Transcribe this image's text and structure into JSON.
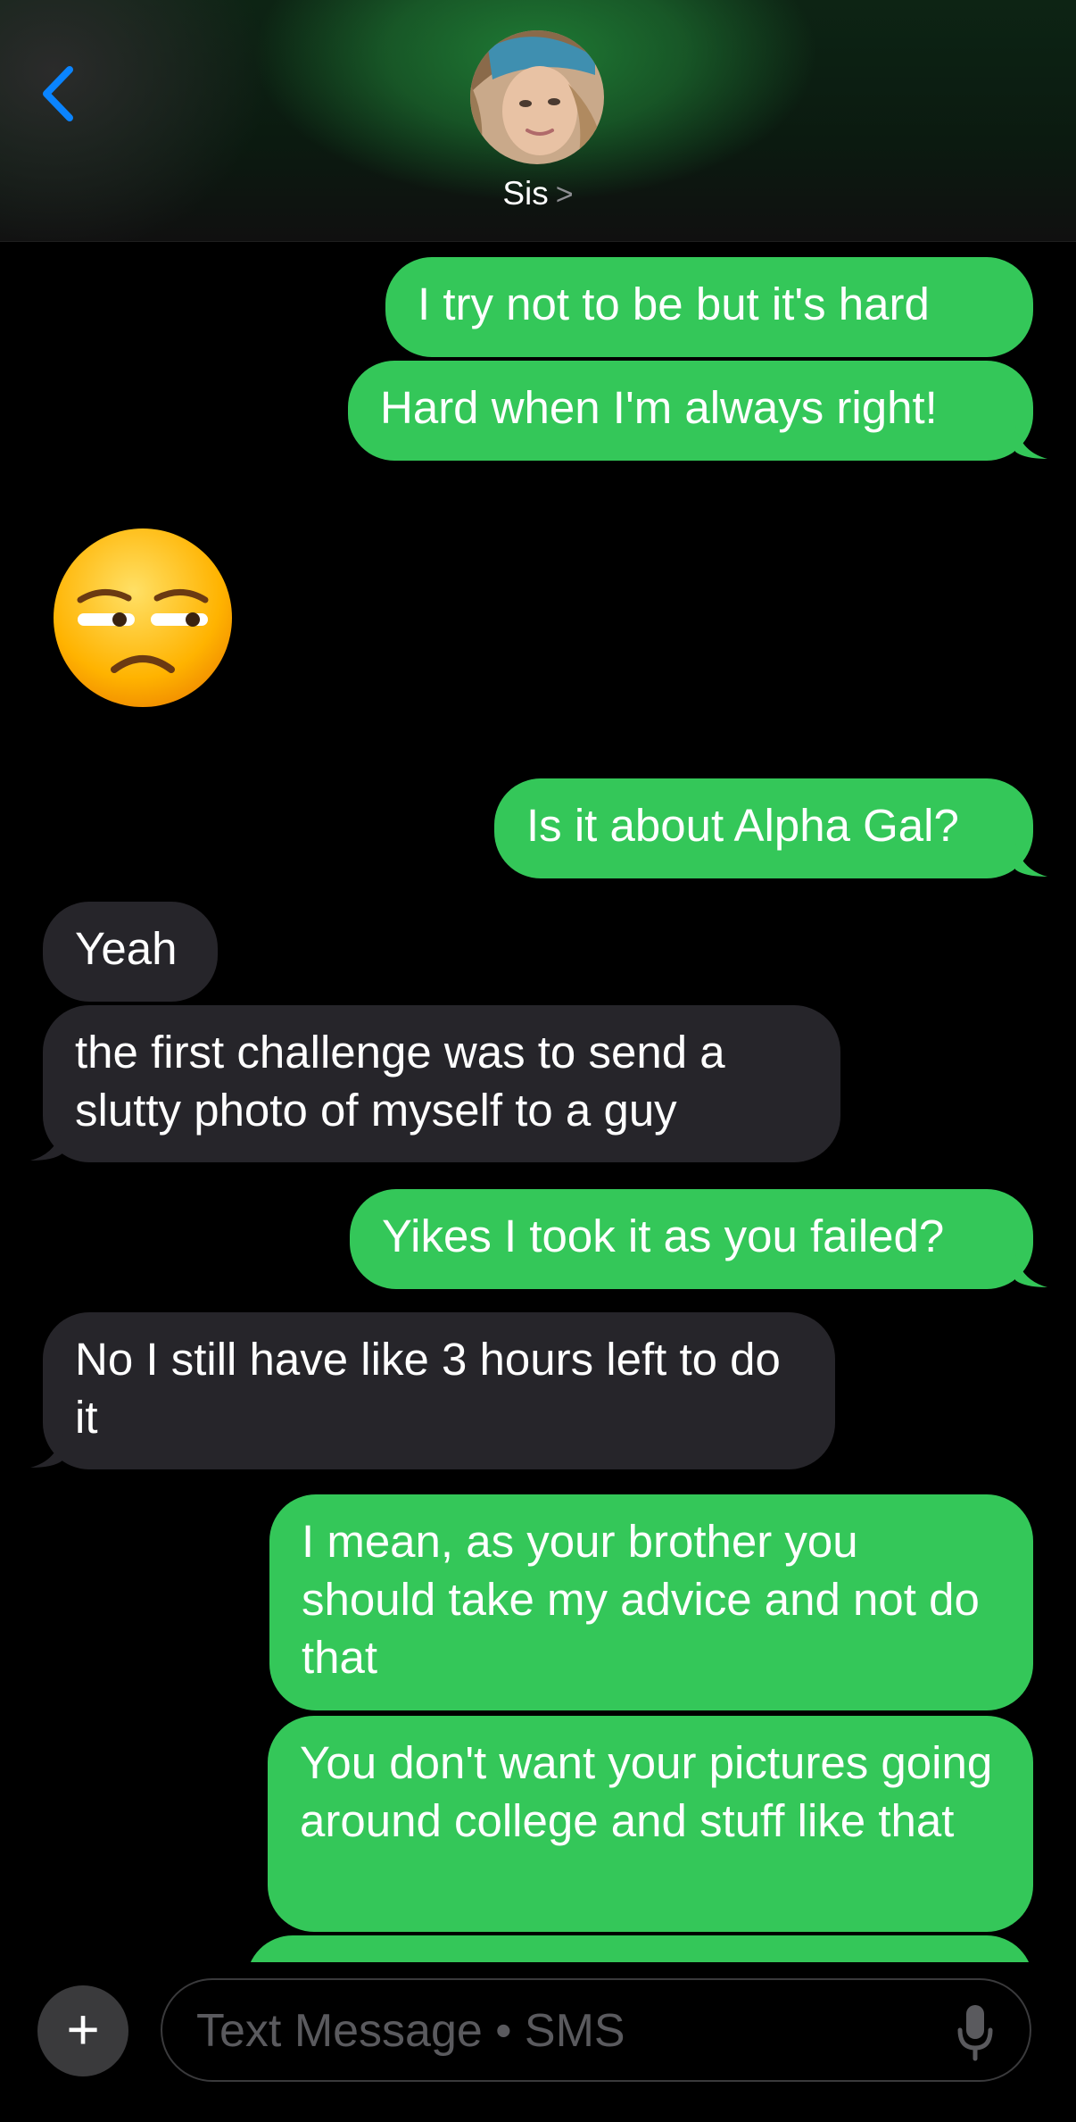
{
  "header": {
    "contact_name": "Sis",
    "chevron": ">"
  },
  "messages": [
    {
      "dir": "out",
      "text": "I try not to be but it's hard"
    },
    {
      "dir": "out",
      "text": "Hard when I'm always right!"
    },
    {
      "dir": "in",
      "emoji": "unamused-face-emoji"
    },
    {
      "dir": "out",
      "text": "Is it about Alpha Gal?"
    },
    {
      "dir": "in",
      "text": "Yeah"
    },
    {
      "dir": "in",
      "text": "the first challenge was to send a slutty  photo of myself to a guy"
    },
    {
      "dir": "out",
      "text": "Yikes I took it as you failed?"
    },
    {
      "dir": "in",
      "text": "No I still have like 3 hours left to do it"
    },
    {
      "dir": "out",
      "text": "I mean, as your brother you should take my advice and not do that"
    },
    {
      "dir": "out",
      "text": "You don't want your pictures going around college and stuff like that"
    }
  ],
  "input": {
    "placeholder": "Text Message • SMS",
    "plus": "+"
  },
  "colors": {
    "outgoing": "#34c759",
    "incoming": "#26252a",
    "accent": "#0a84ff"
  }
}
